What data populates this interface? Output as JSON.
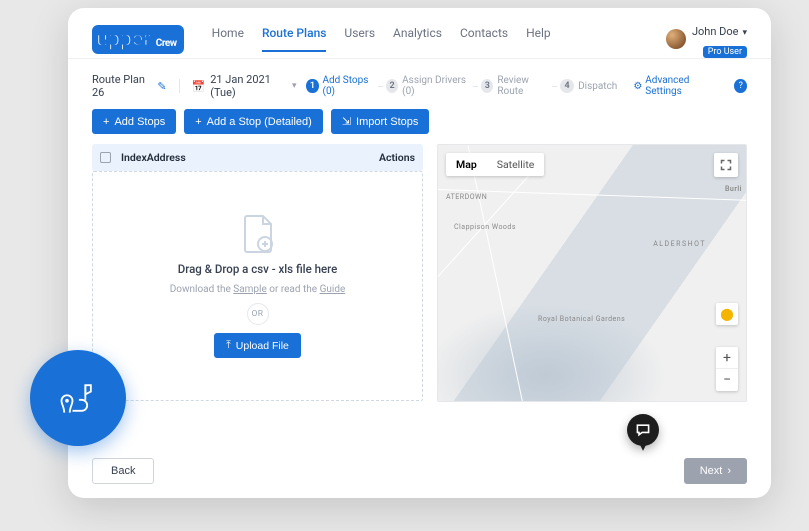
{
  "brand": {
    "name": "upper",
    "sub": "Crew"
  },
  "nav": {
    "home": "Home",
    "route_plans": "Route Plans",
    "users": "Users",
    "analytics": "Analytics",
    "contacts": "Contacts",
    "help": "Help"
  },
  "user": {
    "name": "John Doe",
    "badge": "Pro User"
  },
  "toolbar": {
    "route_name": "Route Plan 26",
    "date": "21 Jan 2021 (Tue)",
    "steps": {
      "s1": "Add Stops (0)",
      "s2": "Assign Drivers (0)",
      "s3": "Review Route",
      "s4": "Dispatch"
    },
    "advanced": "Advanced Settings",
    "help_char": "?"
  },
  "buttons": {
    "add_stops": "Add Stops",
    "add_detailed": "Add a Stop (Detailed)",
    "import_stops": "Import Stops"
  },
  "table": {
    "index": "Index",
    "address": "Address",
    "actions": "Actions"
  },
  "dropzone": {
    "title": "Drag & Drop a csv - xls file here",
    "sub_prefix": "Download the ",
    "sample": "Sample",
    "sub_mid": " or read the ",
    "guide": "Guide",
    "or": "OR",
    "upload": "Upload File"
  },
  "map": {
    "map": "Map",
    "satellite": "Satellite",
    "labels": {
      "aterdown": "ATERDOWN",
      "clappison": "Clappison Woods",
      "aldershot": "ALDERSHOT",
      "burli": "Burli",
      "botanical": "Royal Botanical Gardens"
    },
    "zoom_in": "+",
    "zoom_out": "−"
  },
  "footer": {
    "back": "Back",
    "next": "Next"
  }
}
